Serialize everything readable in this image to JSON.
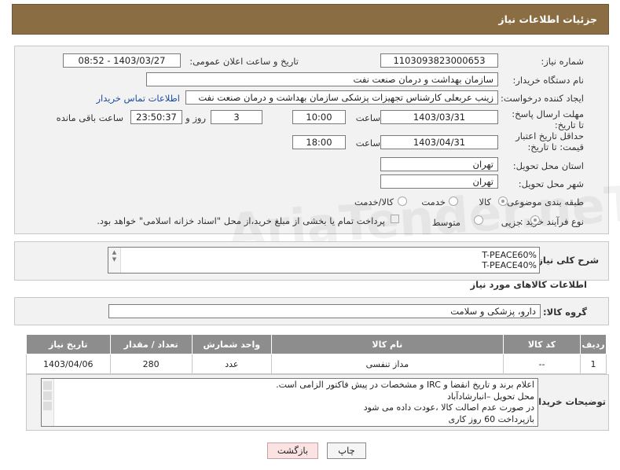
{
  "header": {
    "title": "جزئیات اطلاعات نیاز"
  },
  "form": {
    "need_number_label": "شماره نیاز:",
    "need_number": "1103093823000653",
    "announce_label": "تاریخ و ساعت اعلان عمومی:",
    "announce_value": "1403/03/27 - 08:52",
    "buyer_org_label": "نام دستگاه خریدار:",
    "buyer_org": "سازمان بهداشت و درمان صنعت نفت",
    "creator_label": "ایجاد کننده درخواست:",
    "creator": "زینب عربعلی کارشناس تجهیزات پزشکی سازمان بهداشت و درمان صنعت نفت",
    "contact_link": "اطلاعات تماس خریدار",
    "reply_deadline_label": "مهلت ارسال پاسخ: تا تاریخ:",
    "reply_date": "1403/03/31",
    "time_label": "ساعت",
    "reply_time": "10:00",
    "days_value": "3",
    "days_label": "روز و",
    "remaining_time": "23:50:37",
    "remaining_label": "ساعت باقی مانده",
    "price_deadline_label": "حداقل تاریخ اعتبار قیمت: تا تاریخ:",
    "price_date": "1403/04/31",
    "price_time": "18:00",
    "province_label": "استان محل تحویل:",
    "province": "تهران",
    "city_label": "شهر محل تحویل:",
    "city": "تهران",
    "category_label": "طبقه بندی موضوعی:",
    "category_options": [
      "کالا",
      "خدمت",
      "کالا/خدمت"
    ],
    "process_label": "نوع فرآیند خرید :",
    "process_options": [
      "جزیی",
      "متوسط"
    ],
    "payment_note": "پرداخت تمام یا بخشی از مبلغ خرید،از محل \"اسناد خزانه اسلامی\" خواهد بود."
  },
  "summary": {
    "label": "شرح کلی نیاز:",
    "lines": [
      "T-PEACE60%",
      "T-PEACE40%"
    ]
  },
  "goods_section": {
    "title": "اطلاعات کالاهای مورد نیاز",
    "group_label": "گروه کالا:",
    "group_value": "دارو، پزشکی و سلامت"
  },
  "table": {
    "headers": [
      "ردیف",
      "کد کالا",
      "نام کالا",
      "واحد شمارش",
      "تعداد / مقدار",
      "تاریخ نیاز"
    ],
    "rows": [
      {
        "row": "1",
        "code": "--",
        "name": "مداز تنفسی",
        "unit": "عدد",
        "qty": "280",
        "date": "1403/04/06"
      }
    ]
  },
  "buyer_notes": {
    "label": "توضیحات خریدار:",
    "lines": [
      "اعلام برند و تاریخ انقضا  و IRC  و مشخصات  در پیش فاکتور الزامی است.",
      "محل تحویل –انبارشادآباد",
      "در صورت عدم اصالت کالا ،عودت داده می شود",
      "بازپرداخت 60 روز کاری"
    ]
  },
  "buttons": {
    "print": "چاپ",
    "back": "بازگشت"
  },
  "watermark": "AriaTender.neT"
}
